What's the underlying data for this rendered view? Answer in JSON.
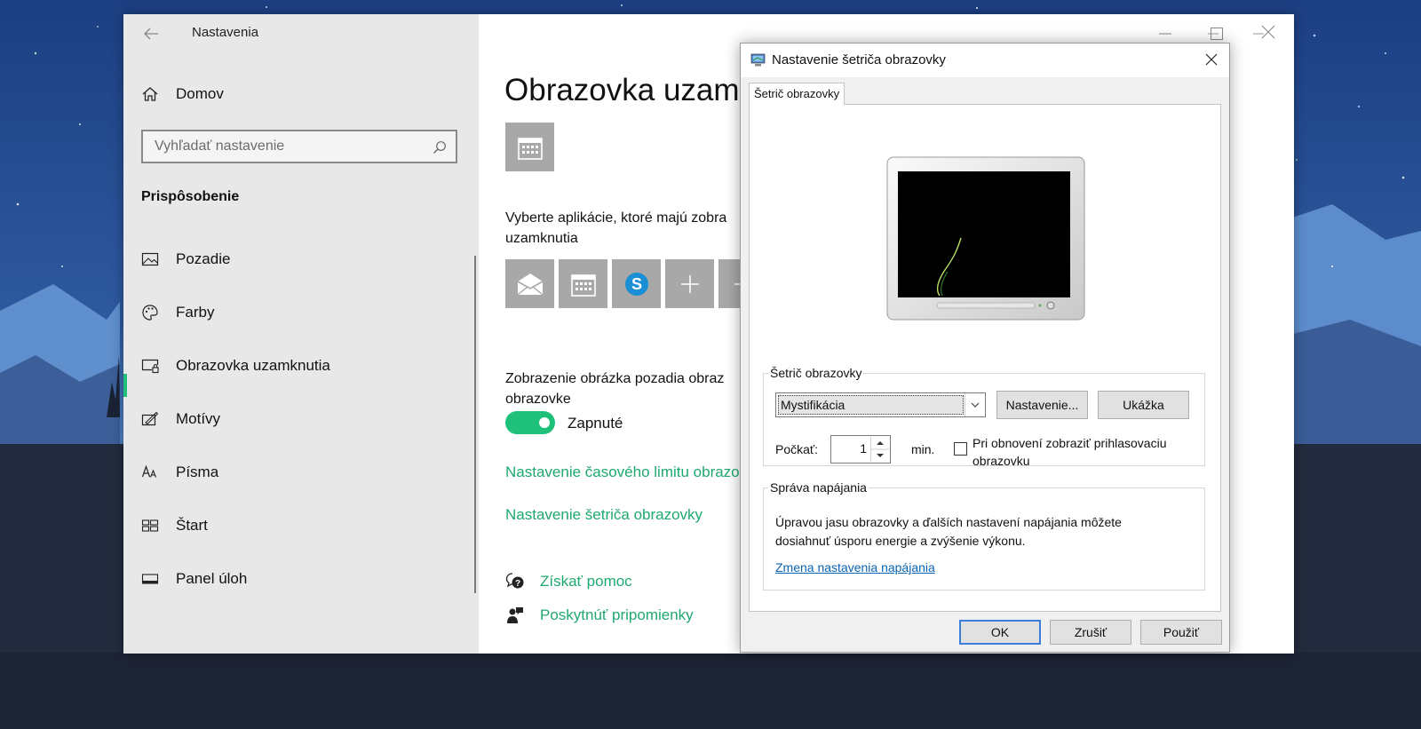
{
  "settings": {
    "title": "Nastavenia",
    "home": "Domov",
    "search_placeholder": "Vyhľadať nastavenie",
    "section": "Prispôsobenie",
    "nav": [
      {
        "label": "Pozadie",
        "icon": "picture-icon"
      },
      {
        "label": "Farby",
        "icon": "palette-icon"
      },
      {
        "label": "Obrazovka uzamknutia",
        "icon": "lock-screen-icon",
        "active": true
      },
      {
        "label": "Motívy",
        "icon": "themes-icon"
      },
      {
        "label": "Písma",
        "icon": "fonts-icon"
      },
      {
        "label": "Štart",
        "icon": "start-icon"
      },
      {
        "label": "Panel úloh",
        "icon": "taskbar-icon"
      }
    ],
    "accent_color": "#1ec07a"
  },
  "main": {
    "page_title": "Obrazovka uzamk",
    "apps_text_line1": "Vyberte aplikácie, ktoré majú zobra",
    "apps_text_line2": "uzamknutia",
    "bg_text_line1": "Zobrazenie obrázka pozadia obraz",
    "bg_text_line2": "obrazovke",
    "toggle_state": "Zapnuté",
    "link_timeout": "Nastavenie časového limitu obrazo",
    "link_screensaver": "Nastavenie šetriča obrazovky",
    "help": "Získať pomoc",
    "feedback": "Poskytnúť pripomienky"
  },
  "dialog": {
    "title": "Nastavenie šetriča obrazovky",
    "tab": "Šetrič obrazovky",
    "group_screensaver": "Šetrič obrazovky",
    "selected_saver": "Mystifikácia",
    "settings_button": "Nastavenie...",
    "preview_button": "Ukážka",
    "wait_label": "Počkať:",
    "wait_value": "1",
    "min_label": "min.",
    "resume_checkbox_line1": "Pri obnovení zobraziť prihlasovaciu",
    "resume_checkbox_line2": "obrazovku",
    "resume_checked": false,
    "group_power": "Správa napájania",
    "power_text_line1": "Úpravou jasu obrazovky a ďalších nastavení napájania môžete",
    "power_text_line2": "dosiahnuť úsporu energie a zvýšenie výkonu.",
    "power_link": "Zmena nastavenia napájania",
    "ok": "OK",
    "cancel": "Zrušiť",
    "apply": "Použiť"
  }
}
